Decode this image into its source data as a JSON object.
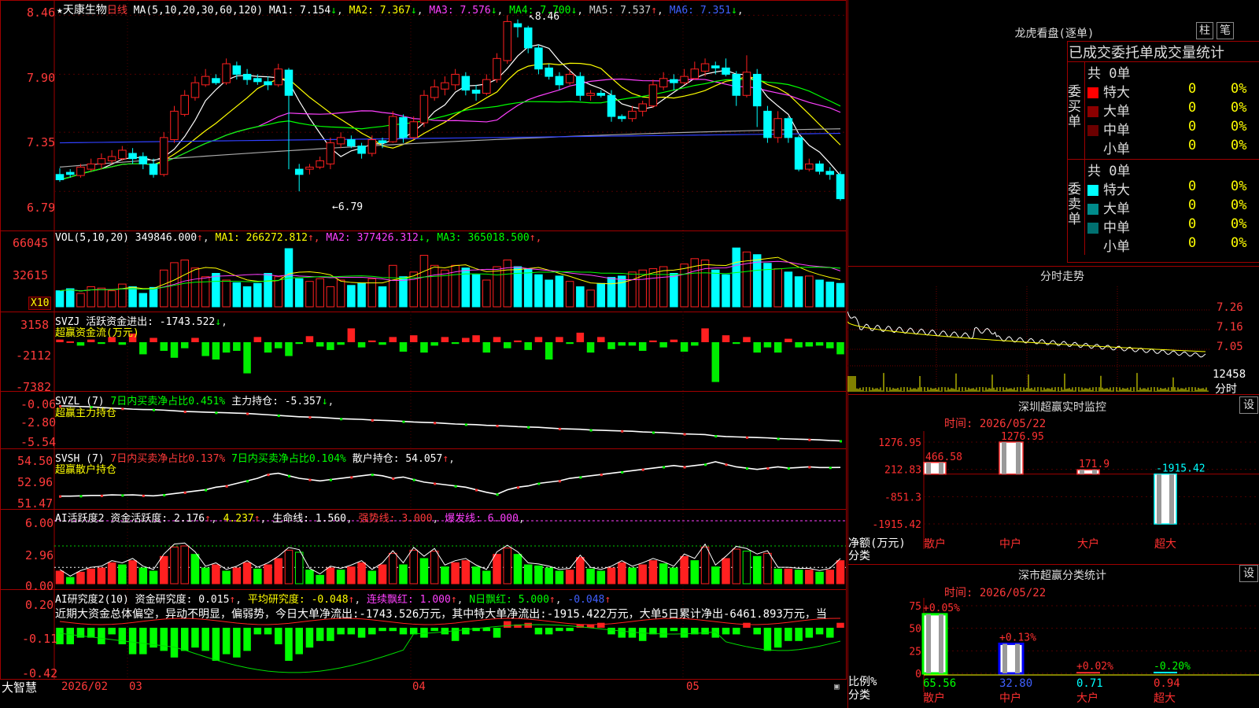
{
  "stock": {
    "name": "天康生物",
    "period": "日线"
  },
  "brand": "大智慧",
  "main": {
    "ma_header": "MA(5,10,20,30,60,120)",
    "ma": [
      {
        "name": "MA1",
        "value": "7.154",
        "arrow": "↓",
        "color": "#ffffff"
      },
      {
        "name": "MA2",
        "value": "7.367",
        "arrow": "↓",
        "color": "#ffff00"
      },
      {
        "name": "MA3",
        "value": "7.576",
        "arrow": "↓",
        "color": "#ff40ff"
      },
      {
        "name": "MA4",
        "value": "7.700",
        "arrow": "↓",
        "color": "#00ff00"
      },
      {
        "name": "MA5",
        "value": "7.537",
        "arrow": "↑",
        "color": "#cccccc"
      },
      {
        "name": "MA6",
        "value": "7.351",
        "arrow": "↓",
        "color": "#4060ff"
      }
    ],
    "y_ticks": [
      "8.46",
      "7.90",
      "7.35",
      "6.79"
    ],
    "high_label": "8.46",
    "low_label": "6.79"
  },
  "vol": {
    "header": "VOL(5,10,20)",
    "value": "349846.000",
    "arrow": "↑",
    "ma": [
      {
        "name": "MA1",
        "value": "266272.812",
        "arrow": "↑",
        "color": "#ffff00"
      },
      {
        "name": "MA2",
        "value": "377426.312",
        "arrow": "↓",
        "color": "#ff40ff"
      },
      {
        "name": "MA3",
        "value": "365018.500",
        "arrow": "↑",
        "color": "#00ff00"
      }
    ],
    "y_ticks": [
      "66045",
      "32615"
    ],
    "unit": "X10"
  },
  "svzj": {
    "header": "SVZJ",
    "label": "活跃资金进出:",
    "value": "-1743.522",
    "arrow": "↓",
    "sub": "超赢资金流(万元)",
    "y_ticks": [
      "3158",
      "-2112",
      "-7382"
    ]
  },
  "svzl": {
    "header": "SVZL (7)",
    "t1": "7日内买卖净占比0.451%",
    "t2": "主力持仓:",
    "v2": "-5.357",
    "arrow": "↓",
    "sub": "超赢主力持仓",
    "y_ticks": [
      "-0.06",
      "-2.80",
      "-5.54"
    ]
  },
  "svsh": {
    "header": "SVSH (7)",
    "t1": "7日内买卖净占比0.137%",
    "t2": "7日内买卖净占比0.104%",
    "t3": "散户持仓:",
    "v3": "54.057",
    "arrow": "↑",
    "sub": "超赢散户持仓",
    "y_ticks": [
      "54.50",
      "52.96",
      "51.47"
    ]
  },
  "ai1": {
    "header": "AI活跃度2",
    "t1": "资金活跃度:",
    "v1": "2.176",
    "v2": "4.237",
    "t3": "生命线:",
    "v3": "1.560",
    "t4": "强势线:",
    "v4": "3.000",
    "t5": "爆发线:",
    "v5": "6.000",
    "y_ticks": [
      "6.00",
      "2.96",
      "0.00"
    ]
  },
  "ai2": {
    "header": "AI研究度2(10)",
    "t1": "资金研究度:",
    "v1": "0.015",
    "t2": "平均研究度:",
    "v2": "-0.048",
    "t3": "连续飘红:",
    "v3": "1.000",
    "t4": "N日飘红:",
    "v4": "5.000",
    "v5": "-0.048",
    "comment": "近期大资金总体偏空，异动不明显，偏弱势，今日大单净流出:-1743.526万元，其中特大单净流出:-1915.422万元，大单5日累计净出-6461.893万元，当",
    "y_ticks": [
      "0.20",
      "-0.11",
      "-0.42"
    ]
  },
  "xaxis": [
    {
      "label": "2026/02"
    },
    {
      "label": "03"
    },
    {
      "label": "04"
    },
    {
      "label": "05"
    }
  ],
  "right": {
    "title": "龙虎看盘(逐单)",
    "btn1": "柱",
    "btn2": "笔",
    "sub": "已成交委托单成交量统计",
    "buy": {
      "side": "委买单",
      "total": "共 0单",
      "rows": [
        {
          "name": "特大",
          "count": "0",
          "pct": "0%",
          "color": "#ff0000"
        },
        {
          "name": "大单",
          "count": "0",
          "pct": "0%",
          "color": "#8b0000"
        },
        {
          "name": "中单",
          "count": "0",
          "pct": "0%",
          "color": "#6b0000"
        },
        {
          "name": "小单",
          "count": "0",
          "pct": "0%",
          "color": "#000000"
        }
      ]
    },
    "sell": {
      "side": "委卖单",
      "total": "共 0单",
      "rows": [
        {
          "name": "特大",
          "count": "0",
          "pct": "0%",
          "color": "#00ffff"
        },
        {
          "name": "大单",
          "count": "0",
          "pct": "0%",
          "color": "#008b8b"
        },
        {
          "name": "中单",
          "count": "0",
          "pct": "0%",
          "color": "#007070"
        },
        {
          "name": "小单",
          "count": "0",
          "pct": "0%",
          "color": "#000000"
        }
      ]
    },
    "intraday": {
      "title": "分时走势",
      "ticks": [
        "7.26",
        "7.16",
        "7.05"
      ],
      "vol": "12458",
      "vol_lbl": "分时"
    },
    "sz_monitor": {
      "title": "深圳超赢实时监控",
      "btn": "设",
      "time": "时间: 2026/05/22",
      "ylabel": "净额(万元)",
      "xlabel": "分类",
      "y_ticks": [
        "1276.95",
        "212.83",
        "-851.3",
        "-1915.42"
      ],
      "chart_data": {
        "type": "bar",
        "categories": [
          "散户",
          "中户",
          "大户",
          "超大"
        ],
        "values": [
          466.58,
          1276.95,
          171.9,
          -1915.42
        ],
        "value_labels": [
          "466.58",
          "1276.95",
          "171.9",
          "-1915.42"
        ],
        "ylim": [
          -1915.42,
          1276.95
        ]
      }
    },
    "sz_class": {
      "title": "深市超赢分类统计",
      "btn": "设",
      "time": "时间: 2026/05/22",
      "ylabel": "比例%",
      "xlabel": "分类",
      "y_ticks": [
        "75",
        "50",
        "25",
        "0"
      ],
      "chart_data": {
        "type": "bar",
        "categories": [
          "散户",
          "中户",
          "大户",
          "超大"
        ],
        "values": [
          65.56,
          32.8,
          0.71,
          0.94
        ],
        "changes": [
          "+0.05%",
          "+0.13%",
          "+0.02%",
          "-0.20%"
        ],
        "value_labels": [
          "65.56",
          "32.80",
          "0.71",
          "0.94"
        ],
        "ylim": [
          0,
          75
        ]
      }
    }
  },
  "chart_data": {
    "type": "candlestick",
    "note_series": "daily",
    "x_range": [
      "2026/02",
      "2026/05/22"
    ],
    "ylim": [
      6.79,
      8.46
    ],
    "candles": [
      [
        6.95,
        6.9,
        7.01,
        6.88
      ],
      [
        6.97,
        6.95,
        7.0,
        6.92
      ],
      [
        6.94,
        7.02,
        7.05,
        6.92
      ],
      [
        7.0,
        7.05,
        7.1,
        6.98
      ],
      [
        7.05,
        7.1,
        7.15,
        7.0
      ],
      [
        7.08,
        7.12,
        7.18,
        7.05
      ],
      [
        7.1,
        7.18,
        7.22,
        7.08
      ],
      [
        7.15,
        7.1,
        7.2,
        7.05
      ],
      [
        7.12,
        7.05,
        7.16,
        7.0
      ],
      [
        7.05,
        6.95,
        7.1,
        6.92
      ],
      [
        6.95,
        7.3,
        7.35,
        6.93
      ],
      [
        7.28,
        7.55,
        7.6,
        7.25
      ],
      [
        7.52,
        7.7,
        7.75,
        7.5
      ],
      [
        7.68,
        7.82,
        7.88,
        7.65
      ],
      [
        7.8,
        7.88,
        7.95,
        7.78
      ],
      [
        7.86,
        7.82,
        7.9,
        7.8
      ],
      [
        7.82,
        8.0,
        8.05,
        7.8
      ],
      [
        7.98,
        7.9,
        8.02,
        7.85
      ],
      [
        7.9,
        7.85,
        7.95,
        7.8
      ],
      [
        7.86,
        7.83,
        7.9,
        7.8
      ],
      [
        7.83,
        7.8,
        7.88,
        7.75
      ],
      [
        7.8,
        7.95,
        8.0,
        7.78
      ],
      [
        7.94,
        7.7,
        7.96,
        7.0
      ],
      [
        7.0,
        6.95,
        7.05,
        6.79
      ],
      [
        7.0,
        7.02,
        7.05,
        6.95
      ],
      [
        7.02,
        7.08,
        7.12,
        7.0
      ],
      [
        7.05,
        7.25,
        7.3,
        7.0
      ],
      [
        7.24,
        7.3,
        7.35,
        7.2
      ],
      [
        7.28,
        7.22,
        7.32,
        7.2
      ],
      [
        7.22,
        7.15,
        7.25,
        7.1
      ],
      [
        7.15,
        7.28,
        7.32,
        7.12
      ],
      [
        7.27,
        7.25,
        7.3,
        7.2
      ],
      [
        7.26,
        7.5,
        7.55,
        7.25
      ],
      [
        7.49,
        7.3,
        7.52,
        7.25
      ],
      [
        7.3,
        7.45,
        7.5,
        7.28
      ],
      [
        7.44,
        7.7,
        7.75,
        7.4
      ],
      [
        7.68,
        7.78,
        7.85,
        7.65
      ],
      [
        7.76,
        7.82,
        7.88,
        7.7
      ],
      [
        7.8,
        7.9,
        7.95,
        7.75
      ],
      [
        7.88,
        7.75,
        7.92,
        7.7
      ],
      [
        7.75,
        7.72,
        7.8,
        7.65
      ],
      [
        7.72,
        7.85,
        7.9,
        7.7
      ],
      [
        7.85,
        8.05,
        8.1,
        7.82
      ],
      [
        8.03,
        8.4,
        8.46,
        8.0
      ],
      [
        8.38,
        8.35,
        8.42,
        8.25
      ],
      [
        8.34,
        8.15,
        8.36,
        8.1
      ],
      [
        8.15,
        7.95,
        8.18,
        7.9
      ],
      [
        7.96,
        7.88,
        8.0,
        7.85
      ],
      [
        7.88,
        7.8,
        7.92,
        7.75
      ],
      [
        7.82,
        7.9,
        7.95,
        7.8
      ],
      [
        7.88,
        7.7,
        7.92,
        7.65
      ],
      [
        7.7,
        7.72,
        7.75,
        7.65
      ],
      [
        7.72,
        7.7,
        7.75,
        7.68
      ],
      [
        7.7,
        7.5,
        7.75,
        7.45
      ],
      [
        7.5,
        7.48,
        7.52,
        7.45
      ],
      [
        7.48,
        7.55,
        7.6,
        7.45
      ],
      [
        7.55,
        7.62,
        7.65,
        7.5
      ],
      [
        7.6,
        7.8,
        7.85,
        7.58
      ],
      [
        7.78,
        7.86,
        7.92,
        7.75
      ],
      [
        7.85,
        7.82,
        7.9,
        7.75
      ],
      [
        7.82,
        7.88,
        7.95,
        7.8
      ],
      [
        7.86,
        7.95,
        8.02,
        7.85
      ],
      [
        7.93,
        8.0,
        8.05,
        7.88
      ],
      [
        7.98,
        7.96,
        8.02,
        7.9
      ],
      [
        7.96,
        7.9,
        8.05,
        7.88
      ],
      [
        7.9,
        7.7,
        7.93,
        7.6
      ],
      [
        7.7,
        7.92,
        8.08,
        7.68
      ],
      [
        7.9,
        7.6,
        7.95,
        7.4
      ],
      [
        7.55,
        7.3,
        7.6,
        7.25
      ],
      [
        7.3,
        7.48,
        7.55,
        7.25
      ],
      [
        7.48,
        7.3,
        7.5,
        7.25
      ],
      [
        7.3,
        7.0,
        7.32,
        6.98
      ],
      [
        7.0,
        7.05,
        7.1,
        6.98
      ],
      [
        7.05,
        6.98,
        7.08,
        6.95
      ],
      [
        6.98,
        6.95,
        7.02,
        6.9
      ],
      [
        6.95,
        6.72,
        6.98,
        6.7
      ]
    ],
    "volume": [
      0.24,
      0.27,
      0.2,
      0.3,
      0.28,
      0.24,
      0.34,
      0.3,
      0.2,
      0.29,
      0.55,
      0.66,
      0.7,
      0.58,
      0.45,
      0.5,
      0.4,
      0.36,
      0.3,
      0.35,
      0.5,
      0.45,
      0.87,
      0.42,
      0.38,
      0.42,
      0.3,
      0.4,
      0.32,
      0.35,
      0.42,
      0.3,
      0.62,
      0.45,
      0.52,
      0.77,
      0.62,
      0.55,
      0.62,
      0.58,
      0.48,
      0.4,
      0.6,
      0.7,
      0.6,
      0.56,
      0.48,
      0.4,
      0.46,
      0.38,
      0.3,
      0.25,
      0.35,
      0.44,
      0.46,
      0.52,
      0.55,
      0.57,
      0.6,
      0.5,
      0.64,
      0.72,
      0.7,
      0.55,
      0.48,
      0.88,
      0.82,
      0.78,
      0.65,
      0.57,
      0.52,
      0.45,
      0.46,
      0.4,
      0.37,
      0.35
    ],
    "svzj": [
      0.15,
      0.05,
      -0.2,
      0.15,
      -0.1,
      0.3,
      -0.15,
      0.5,
      -0.7,
      0.25,
      -0.5,
      -0.9,
      -0.35,
      0.25,
      -0.8,
      -1.0,
      -0.6,
      -0.5,
      -1.8,
      0.3,
      -0.6,
      -0.35,
      -0.8,
      -0.1,
      0.35,
      -0.25,
      -0.45,
      -0.15,
      0.8,
      -0.3,
      0.1,
      -0.15,
      0.3,
      -0.55,
      0.4,
      -0.6,
      -0.2,
      0.3,
      -0.1,
      0.25,
      0.4,
      -0.6,
      0.3,
      -0.35,
      0.1,
      -0.45,
      0.3,
      -1.0,
      0.3,
      -0.1,
      0.55,
      -0.6,
      0.3,
      -0.4,
      -0.2,
      -0.2,
      -0.5,
      0.1,
      -0.3,
      0.15,
      -0.55,
      -0.2,
      0.8,
      -2.3,
      0.4,
      -0.1,
      0.3,
      -0.6,
      -0.3,
      -0.6,
      0.2,
      -0.3,
      -0.25,
      -0.2,
      -0.35,
      -0.7
    ],
    "svzl": [
      -0.06,
      -0.1,
      -0.15,
      -0.2,
      -0.3,
      -0.4,
      -0.45,
      -0.55,
      -0.6,
      -0.62,
      -0.7,
      -0.8,
      -0.9,
      -0.95,
      -1.0,
      -1.05,
      -1.1,
      -1.15,
      -1.2,
      -1.3,
      -1.4,
      -1.5,
      -1.6,
      -1.7,
      -1.75,
      -1.8,
      -1.9,
      -2.0,
      -2.05,
      -2.1,
      -2.2,
      -2.25,
      -2.3,
      -2.4,
      -2.5,
      -2.55,
      -2.6,
      -2.7,
      -2.8,
      -2.85,
      -2.9,
      -3.0,
      -3.05,
      -3.1,
      -3.2,
      -3.25,
      -3.3,
      -3.4,
      -3.5,
      -3.55,
      -3.6,
      -3.7,
      -3.75,
      -3.8,
      -3.85,
      -3.9,
      -4.0,
      -4.05,
      -4.1,
      -4.2,
      -4.3,
      -4.35,
      -4.4,
      -4.6,
      -4.7,
      -4.75,
      -4.8,
      -4.85,
      -4.9,
      -5.0,
      -5.05,
      -5.1,
      -5.15,
      -5.2,
      -5.3,
      -5.357
    ],
    "svsh": [
      51.8,
      51.8,
      51.82,
      51.85,
      51.85,
      51.9,
      51.88,
      51.9,
      51.85,
      51.82,
      51.9,
      52.0,
      52.1,
      52.2,
      52.3,
      52.5,
      52.6,
      52.8,
      53.0,
      53.2,
      53.5,
      53.6,
      53.4,
      53.2,
      53.1,
      53.0,
      53.1,
      53.2,
      53.3,
      53.4,
      53.5,
      53.4,
      53.2,
      53.3,
      53.1,
      52.9,
      52.8,
      52.7,
      52.6,
      52.5,
      52.3,
      52.1,
      51.95,
      52.3,
      52.5,
      52.6,
      52.8,
      52.9,
      53.0,
      53.2,
      53.3,
      53.4,
      53.5,
      53.6,
      53.7,
      53.8,
      53.9,
      54.0,
      54.1,
      54.2,
      54.1,
      54.2,
      54.3,
      54.5,
      54.3,
      54.1,
      54.0,
      53.9,
      54.0,
      54.1,
      54.0,
      54.05,
      54.1,
      54.05,
      54.05,
      54.057
    ],
    "ai1": [
      1.2,
      0.6,
      1.1,
      1.4,
      1.5,
      2.0,
      1.8,
      2.2,
      1.5,
      1.2,
      2.6,
      3.5,
      3.6,
      2.8,
      1.5,
      1.8,
      1.2,
      1.5,
      2.0,
      1.4,
      1.8,
      2.4,
      3.2,
      3.0,
      1.3,
      0.8,
      1.5,
      1.3,
      1.6,
      2.0,
      1.2,
      1.8,
      2.9,
      1.8,
      3.2,
      2.4,
      3.1,
      1.6,
      2.0,
      2.2,
      1.6,
      1.2,
      2.8,
      3.4,
      2.8,
      1.8,
      1.7,
      1.5,
      1.2,
      1.3,
      2.5,
      1.4,
      1.2,
      1.5,
      2.0,
      1.5,
      1.8,
      2.2,
      1.9,
      1.5,
      2.6,
      2.2,
      3.5,
      1.6,
      2.4,
      3.3,
      3.1,
      2.6,
      2.9,
      1.4,
      1.4,
      1.3,
      1.3,
      1.1,
      1.3,
      2.2
    ],
    "ai2": [
      -0.05,
      -0.05,
      -0.03,
      -0.03,
      -0.05,
      -0.02,
      -0.05,
      -0.08,
      -0.08,
      -0.06,
      -0.07,
      -0.09,
      -0.07,
      -0.06,
      -0.07,
      -0.1,
      -0.08,
      -0.09,
      -0.07,
      -0.02,
      -0.02,
      -0.05,
      -0.1,
      -0.08,
      -0.06,
      -0.04,
      -0.04,
      -0.02,
      -0.02,
      -0.03,
      -0.02,
      -0.01,
      -0.01,
      -0.02,
      -0.02,
      -0.03,
      -0.01,
      -0.02,
      -0.04,
      -0.02,
      -0.01,
      -0.01,
      -0.03,
      0.02,
      0.01,
      0.015,
      -0.02,
      -0.02,
      -0.01,
      -0.01,
      0.01,
      0.01,
      0.015,
      -0.02,
      -0.03,
      -0.03,
      -0.04,
      -0.02,
      -0.03,
      -0.01,
      -0.03,
      -0.02,
      -0.02,
      -0.03,
      -0.02,
      -0.02,
      0.015,
      -0.02,
      -0.07,
      -0.06,
      -0.04,
      -0.04,
      -0.03,
      -0.02,
      -0.03,
      0.015
    ]
  }
}
